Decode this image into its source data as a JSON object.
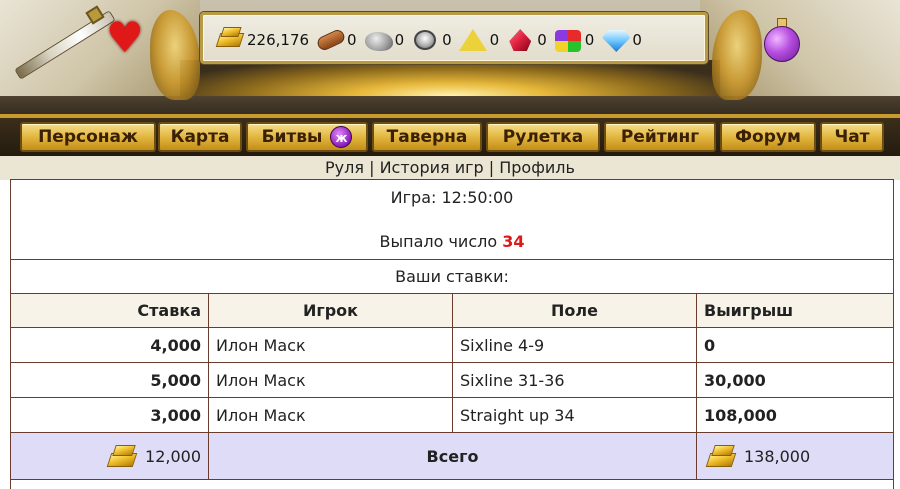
{
  "resources": [
    {
      "icon": "gold-icon",
      "value": "226,176"
    },
    {
      "icon": "wood-icon",
      "value": "0"
    },
    {
      "icon": "stone-icon",
      "value": "0"
    },
    {
      "icon": "iron-icon",
      "value": "0"
    },
    {
      "icon": "sulfur-icon",
      "value": "0"
    },
    {
      "icon": "crystal-icon",
      "value": "0"
    },
    {
      "icon": "gems-icon",
      "value": "0"
    },
    {
      "icon": "diamond-icon",
      "value": "0"
    }
  ],
  "header_icons": {
    "left": "heart-icon",
    "right": "potion-icon"
  },
  "nav": [
    {
      "label": "Персонаж"
    },
    {
      "label": "Карта"
    },
    {
      "label": "Битвы",
      "badge": "ж"
    },
    {
      "label": "Таверна"
    },
    {
      "label": "Рулетка"
    },
    {
      "label": "Рейтинг"
    },
    {
      "label": "Форум"
    },
    {
      "label": "Чат"
    }
  ],
  "subnav": {
    "items": [
      "Руля",
      "История игр",
      "Профиль"
    ],
    "separator": " | "
  },
  "game": {
    "time_label": "Игра: 12:50:00",
    "result_label": "Выпало число",
    "result_number": "34",
    "bets_title": "Ваши ставки:"
  },
  "table": {
    "headers": [
      "Ставка",
      "Игрок",
      "Поле",
      "Выигрыш"
    ],
    "rows": [
      {
        "bet": "4,000",
        "player": "Илон Маск",
        "field": "Sixline 4-9",
        "win": "0"
      },
      {
        "bet": "5,000",
        "player": "Илон Маск",
        "field": "Sixline 31-36",
        "win": "30,000"
      },
      {
        "bet": "3,000",
        "player": "Илон Маск",
        "field": "Straight up 34",
        "win": "108,000"
      }
    ],
    "totals": {
      "bet_total": "12,000",
      "label": "Всего",
      "win_total": "138,000"
    }
  },
  "colors": {
    "accent_gold": "#e2b640",
    "border": "#6a3c2e",
    "totals_bg": "#dedcf6",
    "result_red": "#e01818"
  }
}
